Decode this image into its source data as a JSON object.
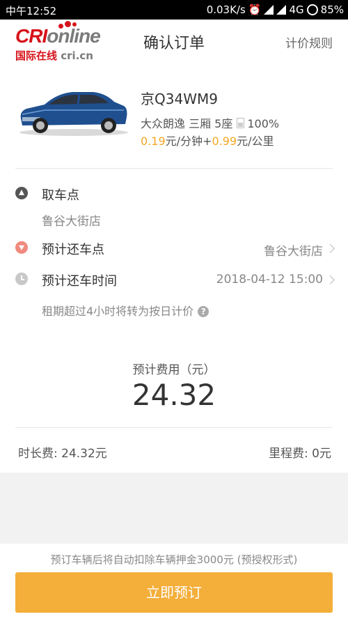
{
  "status_bar": {
    "time": "中午12:52",
    "speed": "0.03K/s",
    "network": "4G",
    "battery": "85%"
  },
  "header": {
    "logo": {
      "brand_red": "CRI",
      "brand_grey": "online",
      "sub_cn": "国际在线",
      "sub_en": "cri.cn"
    },
    "title": "确认订单",
    "pricing_rules": "计价规则"
  },
  "car": {
    "plate": "京Q34WM9",
    "model": "大众朗逸 三厢 5座",
    "fuel_level": "100%",
    "rate_per_min": "0.19",
    "rate_min_unit": "元/分钟+",
    "rate_per_km": "0.99",
    "rate_km_unit": "元/公里"
  },
  "pickup": {
    "label": "取车点",
    "value": "鲁谷大街店"
  },
  "return_point": {
    "label": "预计还车点",
    "value": "鲁谷大街店"
  },
  "return_time": {
    "label": "预计还车时间",
    "value": "2018-04-12 15:00"
  },
  "note": "租期超过4小时将转为按日计价",
  "fee": {
    "title": "预计费用（元）",
    "amount": "24.32",
    "duration_fee": "时长费: 24.32元",
    "mileage_fee": "里程费: 0元"
  },
  "footer": {
    "deposit_note": "预订车辆后将自动扣除车辆押金3000元 (预授权形式)",
    "book_button": "立即预订"
  },
  "colors": {
    "accent": "#f5a623",
    "button": "#f4ae3a",
    "logo_red": "#d6121a"
  }
}
